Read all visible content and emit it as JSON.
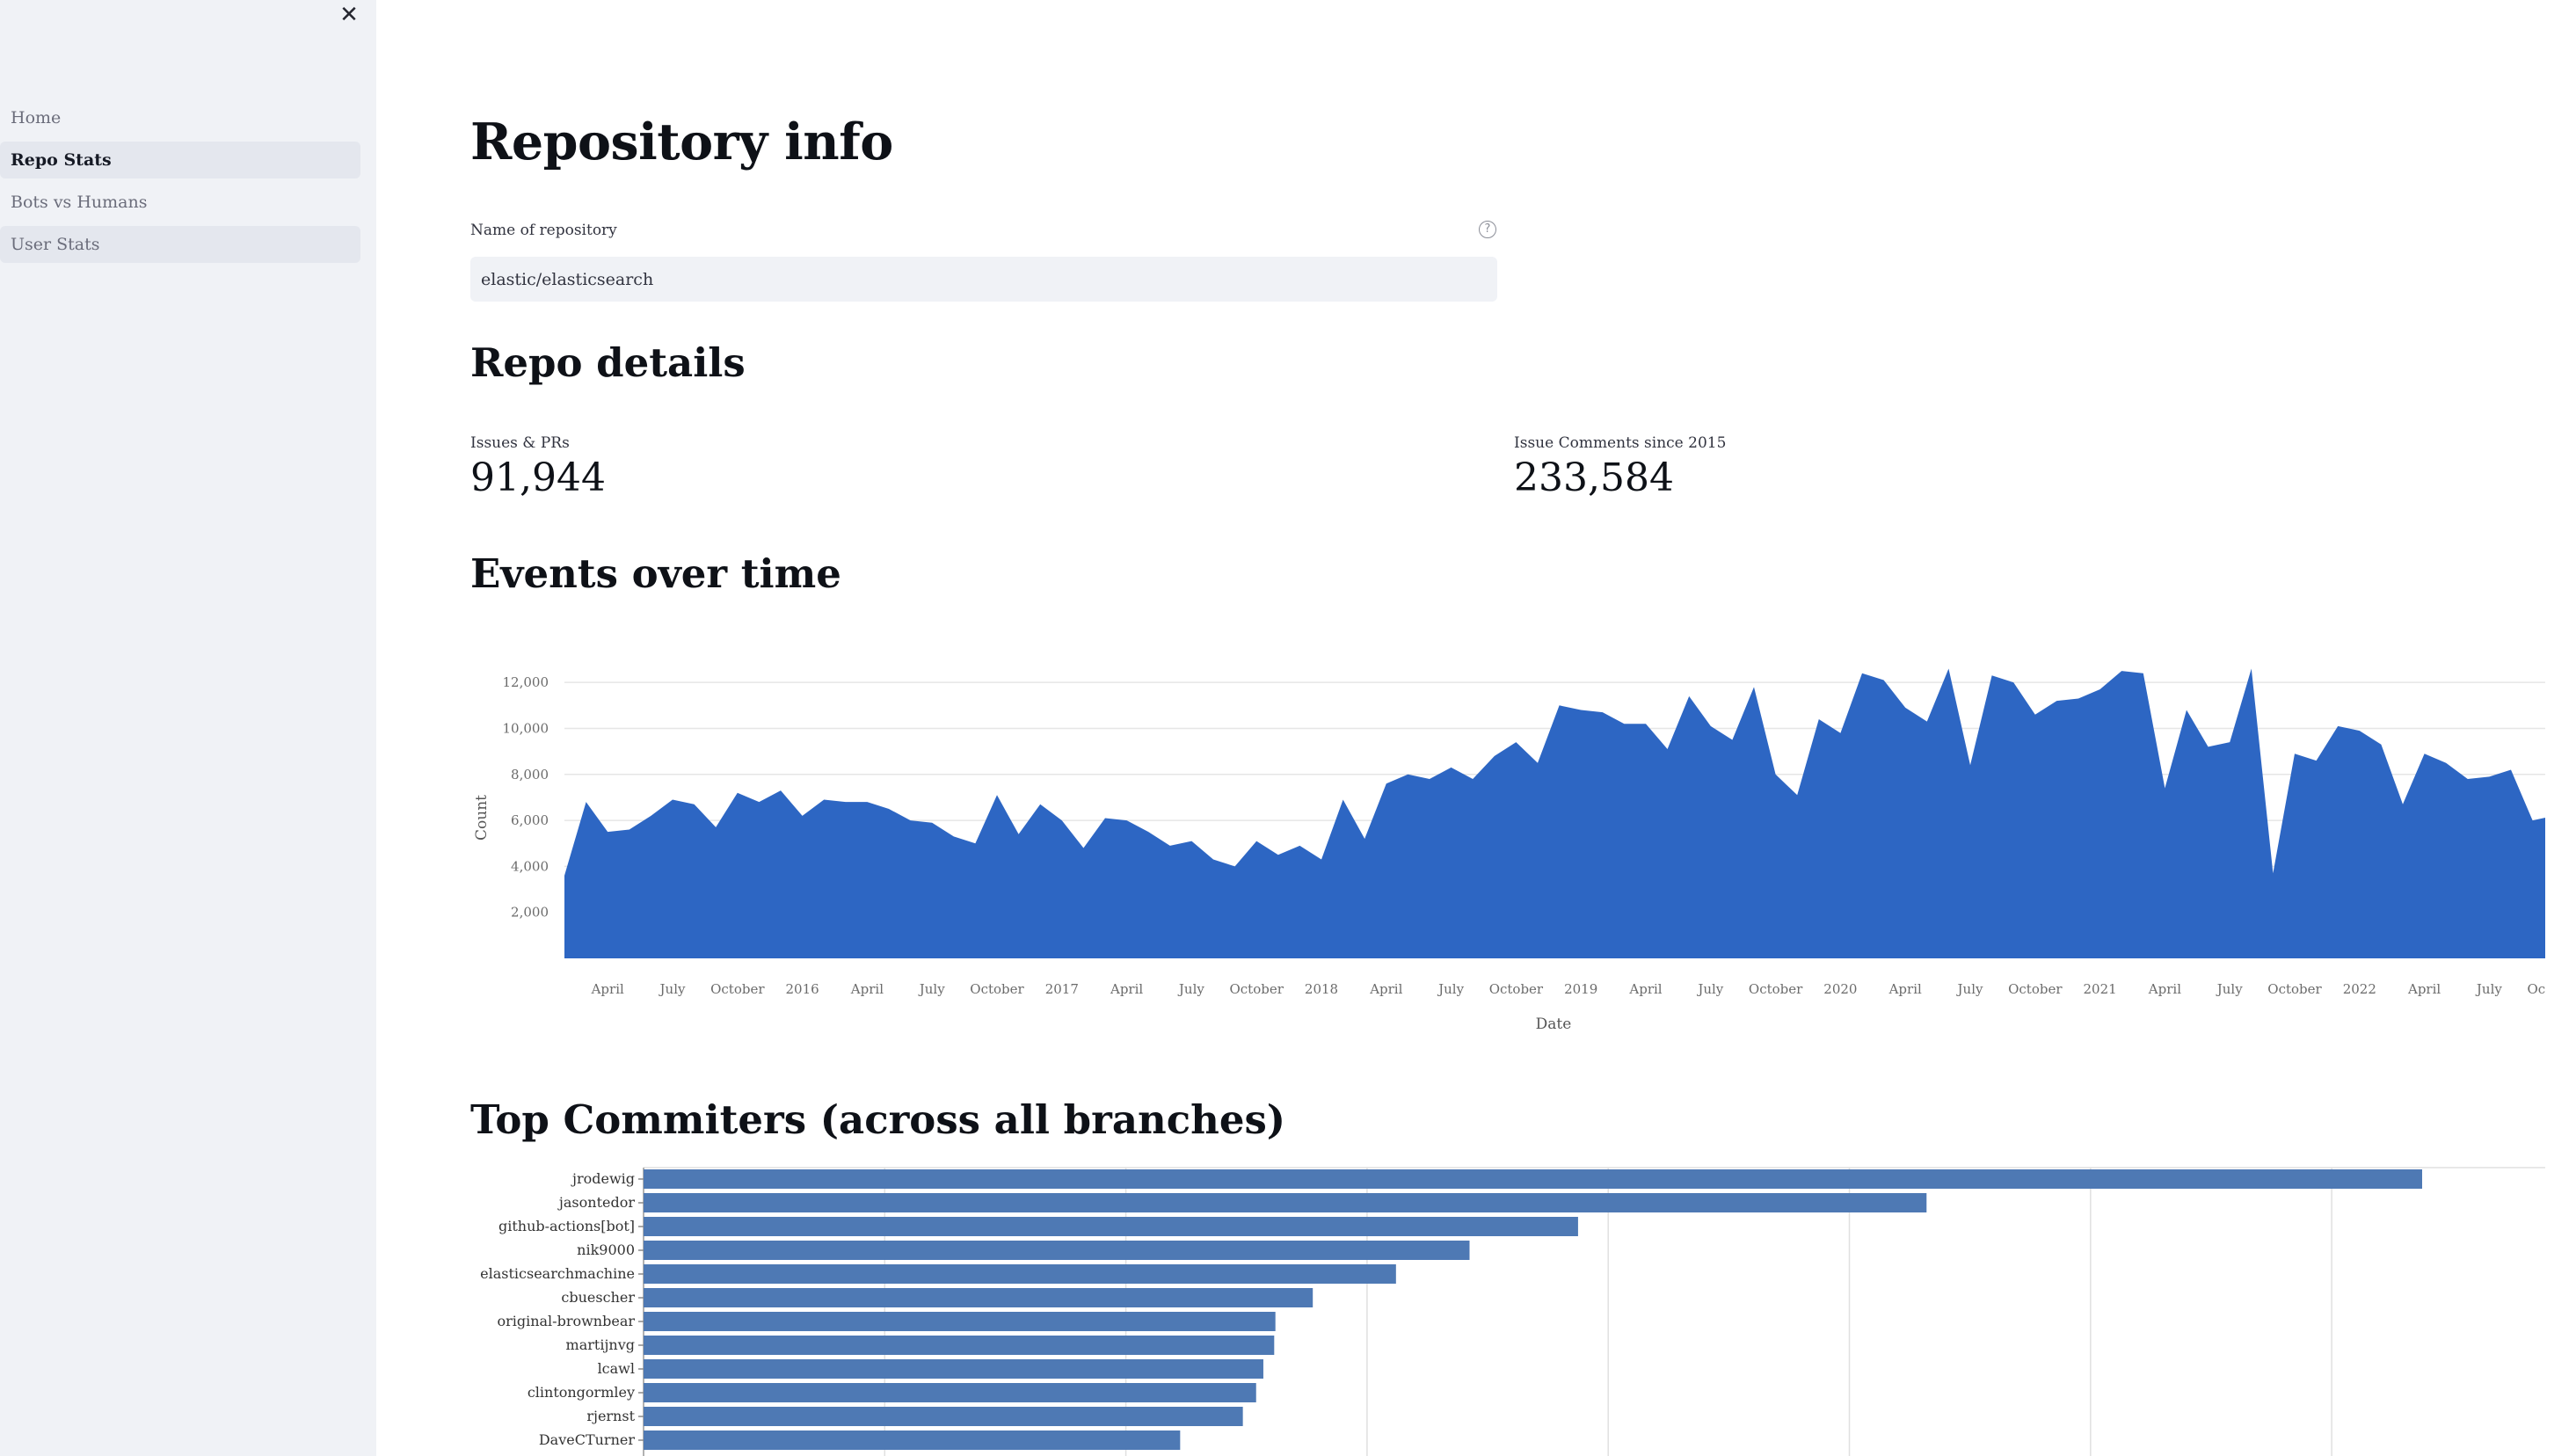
{
  "sidebar": {
    "close_icon": "close-icon",
    "items": [
      {
        "label": "Home",
        "state": "normal"
      },
      {
        "label": "Repo Stats",
        "state": "active"
      },
      {
        "label": "Bots vs Humans",
        "state": "normal"
      },
      {
        "label": "User Stats",
        "state": "hovered"
      }
    ]
  },
  "page": {
    "title": "Repository info",
    "repo_input": {
      "label": "Name of repository",
      "value": "elastic/elasticsearch",
      "help_icon": "question-circle-icon"
    },
    "details_heading": "Repo details",
    "metrics": [
      {
        "label": "Issues & PRs",
        "value": "91,944"
      },
      {
        "label": "Issue Comments since 2015",
        "value": "233,584"
      }
    ],
    "events_heading": "Events over time",
    "committers_heading": "Top Commiters (across all branches)"
  },
  "colors": {
    "area_fill": "#2d66c3",
    "bar_fill": "#4e79b4",
    "sidebar_bg": "#f0f2f6"
  },
  "chart_data": [
    {
      "type": "area",
      "title": "",
      "xlabel": "Date",
      "ylabel": "Count",
      "x_ticks": [
        "April",
        "July",
        "October",
        "2016",
        "April",
        "July",
        "October",
        "2017",
        "April",
        "July",
        "October",
        "2018",
        "April",
        "July",
        "October",
        "2019",
        "April",
        "July",
        "October",
        "2020",
        "April",
        "July",
        "October",
        "2021",
        "April",
        "July",
        "October",
        "2022",
        "April",
        "July",
        "October"
      ],
      "y_ticks": [
        "2,000",
        "4,000",
        "6,000",
        "8,000",
        "10,000",
        "12,000"
      ],
      "ylim": [
        0,
        13000
      ],
      "x_start": "2015-02",
      "x_step": "month",
      "values": [
        3600,
        6800,
        5500,
        5600,
        6200,
        6900,
        6700,
        5700,
        7200,
        6800,
        7300,
        6200,
        6900,
        6800,
        6800,
        6500,
        6000,
        5900,
        5300,
        5000,
        7100,
        5400,
        6700,
        6000,
        4800,
        6100,
        6000,
        5500,
        4900,
        5100,
        4300,
        4000,
        5100,
        4500,
        4900,
        4300,
        6900,
        5200,
        7600,
        8000,
        7800,
        8300,
        7800,
        8800,
        9400,
        8500,
        11000,
        10800,
        10700,
        10200,
        10200,
        9100,
        11400,
        10100,
        9500,
        11800,
        8000,
        7100,
        10400,
        9800,
        12400,
        12100,
        10900,
        10300,
        12600,
        8400,
        12300,
        12000,
        10600,
        11200,
        11300,
        11700,
        12500,
        12400,
        7400,
        10800,
        9200,
        9400,
        12600,
        3700,
        8900,
        8600,
        10100,
        9900,
        9300,
        6700,
        8900,
        8500,
        7800,
        7900,
        8200,
        6000,
        6200
      ]
    },
    {
      "type": "bar",
      "orientation": "horizontal",
      "categories": [
        "jrodewig",
        "jasontedor",
        "github-actions[bot]",
        "nik9000",
        "elasticsearchmachine",
        "cbuescher",
        "original-brownbear",
        "martijnvg",
        "lcawl",
        "clintongormley",
        "rjernst",
        "DaveCTurner"
      ],
      "values": [
        1475,
        1064,
        775,
        685,
        624,
        555,
        524,
        523,
        514,
        508,
        497,
        445
      ],
      "xlim": [
        0,
        1600
      ],
      "x_gridlines": [
        200,
        400,
        600,
        800,
        1000,
        1200,
        1400
      ]
    }
  ]
}
